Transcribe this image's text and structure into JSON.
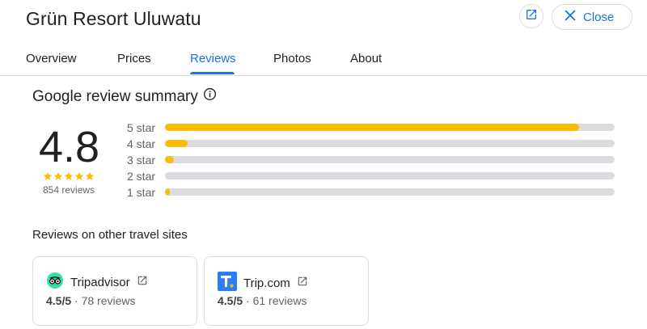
{
  "header": {
    "title": "Grün Resort Uluwatu",
    "close_label": "Close"
  },
  "tabs": [
    {
      "label": "Overview",
      "active": false
    },
    {
      "label": "Prices",
      "active": false
    },
    {
      "label": "Reviews",
      "active": true
    },
    {
      "label": "Photos",
      "active": false
    },
    {
      "label": "About",
      "active": false
    }
  ],
  "summary": {
    "title": "Google review summary",
    "rating": "4.8",
    "stars": 5,
    "review_count": "854 reviews",
    "distribution": [
      {
        "label": "5 star",
        "fraction": 0.92
      },
      {
        "label": "4 star",
        "fraction": 0.05
      },
      {
        "label": "3 star",
        "fraction": 0.02
      },
      {
        "label": "2 star",
        "fraction": 0.0
      },
      {
        "label": "1 star",
        "fraction": 0.01
      }
    ]
  },
  "other_sites": {
    "title": "Reviews on other travel sites",
    "sites": [
      {
        "name": "Tripadvisor",
        "rating": "4.5/5",
        "reviews": "· 78 reviews",
        "icon": "tripadvisor-logo-icon"
      },
      {
        "name": "Trip.com",
        "rating": "4.5/5",
        "reviews": "· 61 reviews",
        "icon": "tripcom-logo-icon"
      }
    ]
  },
  "colors": {
    "accent": "#1a73e8",
    "star": "#fbbc04",
    "track": "#dadce0",
    "tripadvisor": "#34e0a1",
    "tripcom": "#287dfa"
  }
}
